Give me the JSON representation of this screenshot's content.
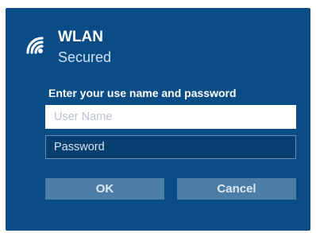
{
  "network": {
    "icon": "wifi-secured-icon",
    "name": "WLAN",
    "status": "Secured"
  },
  "form": {
    "prompt": "Enter your use name and password",
    "username_placeholder": "User Name",
    "username_value": "",
    "password_placeholder": "Password",
    "password_value": ""
  },
  "buttons": {
    "ok_label": "OK",
    "cancel_label": "Cancel"
  },
  "colors": {
    "panel_background": "#0a4c86",
    "button_background": "#4d7ea8",
    "password_field_background": "#073f70"
  }
}
